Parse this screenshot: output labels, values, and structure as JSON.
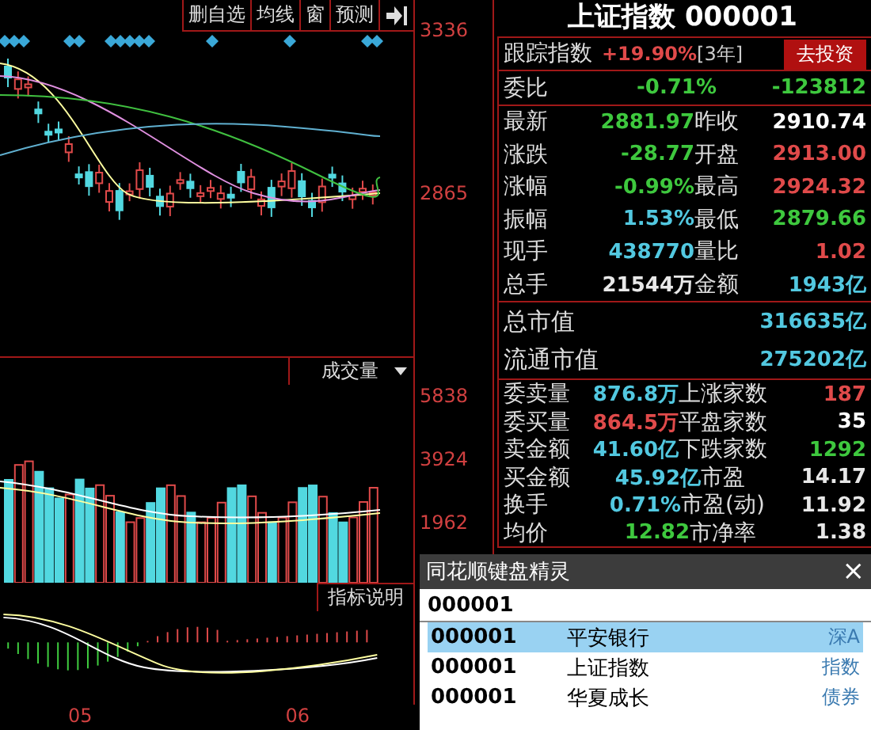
{
  "toolbar": {
    "buttons": [
      "删自选",
      "均线",
      "窗",
      "预测"
    ]
  },
  "price_axis": [
    "3336",
    "2865"
  ],
  "volume_panel": {
    "title": "成交量",
    "ticks": [
      "5838",
      "3924",
      "1962"
    ]
  },
  "indicator_button": "指标说明",
  "date_labels": [
    "05",
    "06"
  ],
  "quote": {
    "title": "上证指数 000001",
    "tracking": {
      "label": "跟踪指数",
      "change": "+19.90%",
      "period": "[3年]",
      "button": "去投资"
    },
    "ratio": {
      "label": "委比",
      "percent": "-0.71%",
      "value": "-123812",
      "color": "#3ec83e"
    },
    "rows": [
      {
        "cells": [
          {
            "label": "最新",
            "value": "2881.97",
            "color": "#3ec83e"
          },
          {
            "label": "昨收",
            "value": "2910.74",
            "color": "#ffffff"
          }
        ]
      },
      {
        "cells": [
          {
            "label": "涨跌",
            "value": "-28.77",
            "color": "#3ec83e"
          },
          {
            "label": "开盘",
            "value": "2913.00",
            "color": "#e04a4a"
          }
        ]
      },
      {
        "cells": [
          {
            "label": "涨幅",
            "value": "-0.99%",
            "color": "#3ec83e"
          },
          {
            "label": "最高",
            "value": "2924.32",
            "color": "#e04a4a"
          }
        ]
      },
      {
        "cells": [
          {
            "label": "振幅",
            "value": "1.53%",
            "color": "#52c8e0"
          },
          {
            "label": "最低",
            "value": "2879.66",
            "color": "#3ec83e"
          }
        ]
      },
      {
        "cells": [
          {
            "label": "现手",
            "value": "438770",
            "color": "#52c8e0"
          },
          {
            "label": "量比",
            "value": "1.02",
            "color": "#e04a4a"
          }
        ]
      },
      {
        "cells": [
          {
            "label": "总手",
            "value": "21544万",
            "color": "#e8e8e8"
          },
          {
            "label": "金额",
            "value": "1943亿",
            "color": "#52c8e0"
          }
        ]
      }
    ],
    "market_cap": [
      {
        "label": "总市值",
        "value": "316635亿"
      },
      {
        "label": "流通市值",
        "value": "275202亿"
      }
    ],
    "order_rows": [
      {
        "cells": [
          {
            "label": "委卖量",
            "value": "876.8万",
            "color": "#52c8e0"
          },
          {
            "label": "上涨家数",
            "value": "187",
            "color": "#e04a4a"
          }
        ]
      },
      {
        "cells": [
          {
            "label": "委买量",
            "value": "864.5万",
            "color": "#e04a4a"
          },
          {
            "label": "平盘家数",
            "value": "35",
            "color": "#ffffff"
          }
        ]
      },
      {
        "cells": [
          {
            "label": "卖金额",
            "value": "41.60亿",
            "color": "#52c8e0"
          },
          {
            "label": "下跌家数",
            "value": "1292",
            "color": "#3ec83e"
          }
        ]
      },
      {
        "cells": [
          {
            "label": "买金额",
            "value": "45.92亿",
            "color": "#52c8e0"
          },
          {
            "label": "市盈",
            "value": "14.17",
            "color": "#e8e8e8"
          }
        ]
      },
      {
        "cells": [
          {
            "label": "换手",
            "value": "0.71%",
            "color": "#52c8e0"
          },
          {
            "label": "市盈(动)",
            "value": "11.92",
            "color": "#e8e8e8"
          }
        ]
      },
      {
        "cells": [
          {
            "label": "均价",
            "value": "12.82",
            "color": "#3ec83e"
          },
          {
            "label": "市净率",
            "value": "1.38",
            "color": "#e8e8e8"
          }
        ]
      }
    ]
  },
  "popup": {
    "title": "同花顺键盘精灵",
    "close": "×",
    "query": "000001",
    "results": [
      {
        "code": "000001",
        "name": "平安银行",
        "market": "深A",
        "selected": true
      },
      {
        "code": "000001",
        "name": "上证指数",
        "market": "指数",
        "selected": false
      },
      {
        "code": "000001",
        "name": "华夏成长",
        "market": "债券",
        "selected": false
      }
    ]
  }
}
